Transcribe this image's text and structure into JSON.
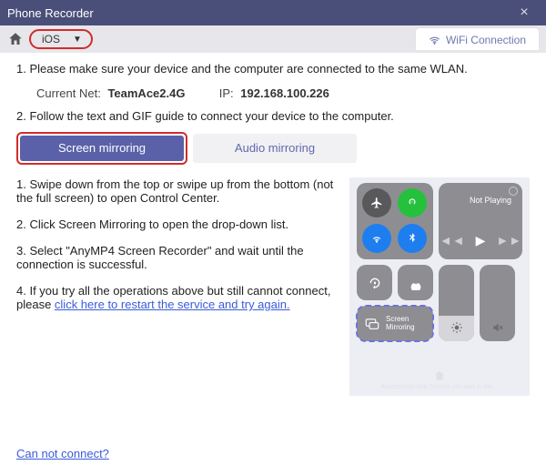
{
  "titlebar": {
    "title": "Phone Recorder"
  },
  "toolbar": {
    "os_selected": "iOS",
    "wifi_tab": "WiFi Connection"
  },
  "steps": {
    "s1": "1. Please make sure your device and the computer are connected to the same WLAN.",
    "s2": "2. Follow the text and GIF guide to connect your device to the computer."
  },
  "net": {
    "current_net_label": "Current Net:",
    "current_net_value": "TeamAce2.4G",
    "ip_label": "IP:",
    "ip_value": "192.168.100.226"
  },
  "tabs": {
    "screen": "Screen mirroring",
    "audio": "Audio mirroring"
  },
  "instructions": {
    "i1": "1. Swipe down from the top or swipe up from the bottom (not the full screen) to open Control Center.",
    "i2": "2. Click Screen Mirroring to open the drop-down list.",
    "i3": "3. Select \"AnyMP4 Screen Recorder\" and wait until the connection is successful.",
    "i4_pre": "4. If you try all the operations above but still cannot connect, please ",
    "i4_link": "click here to restart the service and try again."
  },
  "control_center": {
    "not_playing": "Not Playing",
    "screen_mirroring": "Screen Mirroring",
    "bottom_hint": "Accessories and Scenes you add in the…"
  },
  "footer": {
    "cannot_connect": "Can not connect?"
  }
}
